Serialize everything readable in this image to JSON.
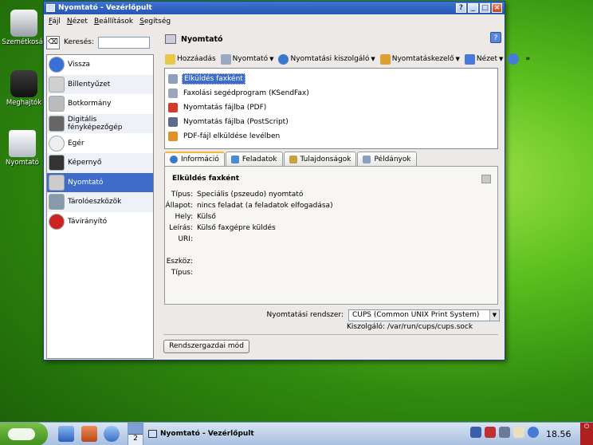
{
  "desktop": {
    "icons": [
      {
        "label": "Szemétkosár",
        "icon": "trash-icon"
      },
      {
        "label": "Meghajtók",
        "icon": "drives-icon"
      },
      {
        "label": "Nyomtató",
        "icon": "printer-icon"
      }
    ]
  },
  "window": {
    "title": "Nyomtató - Vezérlőpult",
    "menu": [
      "Fájl",
      "Nézet",
      "Beállítások",
      "Segítség"
    ]
  },
  "left": {
    "search_label": "Keresés:",
    "search_value": "",
    "items": [
      {
        "label": "Vissza",
        "color": "#3a6fd8"
      },
      {
        "label": "Billentyűzet",
        "color": "#d0d0d0"
      },
      {
        "label": "Botkormány",
        "color": "#bbbbbb"
      },
      {
        "label": "Digitális fényképezőgép",
        "color": "#666666"
      },
      {
        "label": "Egér",
        "color": "#eeeeee"
      },
      {
        "label": "Képernyő",
        "color": "#333333"
      },
      {
        "label": "Nyomtató",
        "color": "#cccccc"
      },
      {
        "label": "Tárolóeszközök",
        "color": "#8899aa"
      },
      {
        "label": "Távirányító",
        "color": "#cc2222"
      }
    ],
    "selected_index": 6
  },
  "right": {
    "header": "Nyomtató",
    "toolbar": [
      {
        "label": "Hozzáadás",
        "color": "#e8c84a",
        "dropdown": false
      },
      {
        "label": "Nyomtató",
        "color": "#9aa8c0",
        "dropdown": true
      },
      {
        "label": "Nyomtatási kiszolgáló",
        "color": "#3a78d0",
        "dropdown": true
      },
      {
        "label": "Nyomtatáskezelő",
        "color": "#e0a030",
        "dropdown": true
      },
      {
        "label": "Nézet",
        "color": "#4a7ad8",
        "dropdown": true
      }
    ],
    "list": [
      {
        "label": "Elküldés faxként",
        "color": "#8fa0bd"
      },
      {
        "label": "Faxolási segédprogram (KSendFax)",
        "color": "#9aa6bb"
      },
      {
        "label": "Nyomtatás fájlba (PDF)",
        "color": "#d33a2a"
      },
      {
        "label": "Nyomtatás fájlba (PostScript)",
        "color": "#5a6a88"
      },
      {
        "label": "PDF-fájl elküldése levélben",
        "color": "#e2902a"
      }
    ],
    "selected_list_index": 0,
    "tabs": [
      {
        "label": "Információ",
        "color": "#3a78d0"
      },
      {
        "label": "Feladatok",
        "color": "#4a8ad8"
      },
      {
        "label": "Tulajdonságok",
        "color": "#c8a040"
      },
      {
        "label": "Példányok",
        "color": "#8aa0c0"
      }
    ],
    "active_tab": 0,
    "info": {
      "title": "Elküldés faxként",
      "rows": [
        {
          "key": "Típus:",
          "value": "Speciális (pszeudo) nyomtató"
        },
        {
          "key": "Állapot:",
          "value": "nincs feladat (a feladatok elfogadása)"
        },
        {
          "key": "Hely:",
          "value": "Külső"
        },
        {
          "key": "Leírás:",
          "value": "Külső faxgépre küldés"
        },
        {
          "key": "URI:",
          "value": ""
        },
        {
          "key": "Eszköz:",
          "value": ""
        },
        {
          "key": "Típus:",
          "value": ""
        }
      ]
    },
    "print_system_label": "Nyomtatási rendszer:",
    "print_system_value": "CUPS (Common UNIX Print System)",
    "server_label": "Kiszolgáló: /var/run/cups/cups.sock",
    "admin_button": "Rendszergazdai mód"
  },
  "taskbar": {
    "pager_number": "2",
    "task_title": "Nyomtató - Vezérlőpult",
    "clock": "18.56"
  }
}
